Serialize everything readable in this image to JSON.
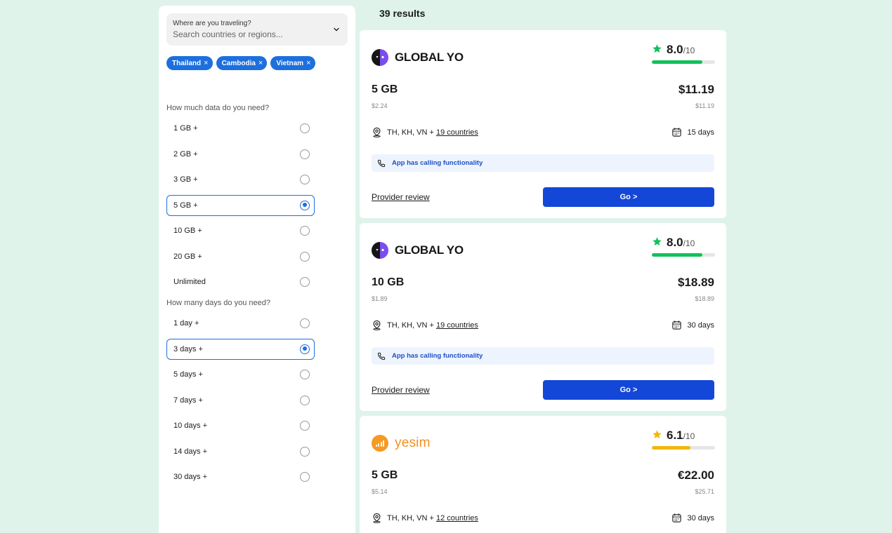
{
  "sidebar": {
    "search": {
      "label": "Where are you traveling?",
      "placeholder": "Search countries or regions..."
    },
    "chips": [
      {
        "label": "Thailand",
        "remove": "×"
      },
      {
        "label": "Cambodia",
        "remove": "×"
      },
      {
        "label": "Vietnam",
        "remove": "×"
      }
    ],
    "data_section": {
      "title": "How much data do you need?",
      "selected": "5 GB +",
      "options": [
        "1 GB +",
        "2 GB +",
        "3 GB +",
        "5 GB +",
        "10 GB +",
        "20 GB +",
        "Unlimited"
      ]
    },
    "days_section": {
      "title": "How many days do you need?",
      "selected": "3 days +",
      "options": [
        "1 day +",
        "3 days +",
        "5 days +",
        "7 days +",
        "10 days +",
        "14 days +",
        "30 days +"
      ]
    }
  },
  "results": {
    "count": "39 results",
    "cards": [
      {
        "provider": "GLOBAL YO",
        "logo": "globalyo-logo",
        "rating": "8.0",
        "rating_max": "/10",
        "rating_fraction": 0.8,
        "rating_color": "#12c15a",
        "data": "5 GB",
        "price": "$11.19",
        "per_gb": "$2.24",
        "price_sub": "$11.19",
        "countries_prefix": "TH, KH, VN + ",
        "countries_link": "19 countries",
        "duration": "15 days",
        "feature": "App has calling functionality",
        "review": "Provider review",
        "cta": "Go >"
      },
      {
        "provider": "GLOBAL YO",
        "logo": "globalyo-logo",
        "rating": "8.0",
        "rating_max": "/10",
        "rating_fraction": 0.8,
        "rating_color": "#12c15a",
        "data": "10 GB",
        "price": "$18.89",
        "per_gb": "$1.89",
        "price_sub": "$18.89",
        "countries_prefix": "TH, KH, VN + ",
        "countries_link": "19 countries",
        "duration": "30 days",
        "feature": "App has calling functionality",
        "review": "Provider review",
        "cta": "Go >"
      },
      {
        "provider": "yesim",
        "logo": "yesim-logo",
        "rating": "6.1",
        "rating_max": "/10",
        "rating_fraction": 0.61,
        "rating_color": "#f2b70f",
        "data": "5 GB",
        "price": "€22.00",
        "per_gb": "$5.14",
        "price_sub": "$25.71",
        "countries_prefix": "TH, KH, VN + ",
        "countries_link": "12 countries",
        "duration": "30 days"
      }
    ]
  },
  "colors": {
    "accent": "#1d6fde",
    "cta": "#1447d8",
    "background": "#dff3ea"
  }
}
